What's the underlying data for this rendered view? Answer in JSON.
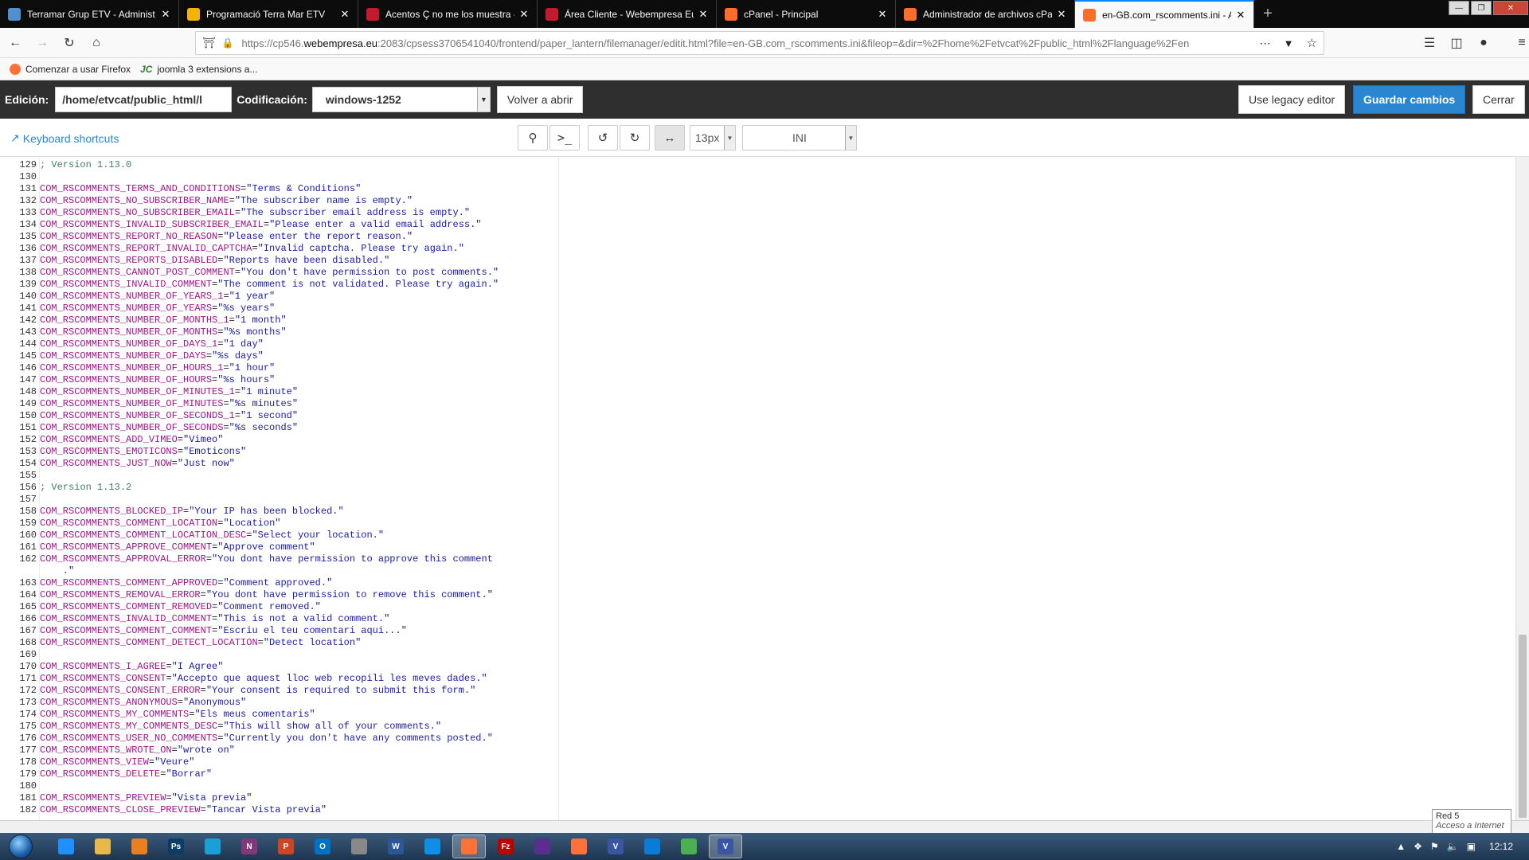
{
  "browser": {
    "tabs": [
      {
        "label": "Terramar Grup ETV - Administ",
        "icon": "joomla-icon",
        "color": "#5091cd"
      },
      {
        "label": "Programació Terra Mar ETV",
        "icon": "google-drive-icon",
        "color": "#f4b400"
      },
      {
        "label": "Acentos Ç no me los muestra -",
        "icon": "webempresa-icon",
        "color": "#c21b2f"
      },
      {
        "label": "Área Cliente - Webempresa Eur",
        "icon": "webempresa-icon",
        "color": "#c21b2f"
      },
      {
        "label": "cPanel - Principal",
        "icon": "cpanel-icon",
        "color": "#ff6c2c"
      },
      {
        "label": "Administrador de archivos cPar",
        "icon": "cpanel-icon",
        "color": "#ff6c2c"
      },
      {
        "label": "en-GB.com_rscomments.ini - A",
        "icon": "cpanel-icon",
        "color": "#ff6c2c"
      }
    ],
    "url_prefix": "https://cp546.",
    "url_domain": "webempresa.eu",
    "url_rest": ":2083/cpsess3706541040/frontend/paper_lantern/filemanager/editit.html?file=en-GB.com_rscomments.ini&fileop=&dir=%2Fhome%2Fetvcat%2Fpublic_html%2Flanguage%2Fen",
    "bookmarks": [
      {
        "label": "Comenzar a usar Firefox",
        "icon": "firefox-icon"
      },
      {
        "label": "joomla 3 extensions a...",
        "icon": "jc-icon"
      }
    ]
  },
  "editor": {
    "edit_label": "Edición:",
    "path_value": "/home/etvcat/public_html/l",
    "encoding_label": "Codificación:",
    "encoding_value": "windows-1252",
    "reopen_label": "Volver a abrir",
    "legacy_label": "Use legacy editor",
    "save_label": "Guardar cambios",
    "close_label": "Cerrar",
    "keyboard_shortcuts": "Keyboard shortcuts",
    "font_size": "13px",
    "mode": "INI"
  },
  "code_lines": [
    {
      "n": "129",
      "t": "comment",
      "text": "; Version 1.13.0"
    },
    {
      "n": "130",
      "t": "blank"
    },
    {
      "n": "131",
      "k": "COM_RSCOMMENTS_TERMS_AND_CONDITIONS",
      "v": "\"Terms & Conditions\""
    },
    {
      "n": "132",
      "k": "COM_RSCOMMENTS_NO_SUBSCRIBER_NAME",
      "v": "\"The subscriber name is empty.\""
    },
    {
      "n": "133",
      "k": "COM_RSCOMMENTS_NO_SUBSCRIBER_EMAIL",
      "v": "\"The subscriber email address is empty.\""
    },
    {
      "n": "134",
      "k": "COM_RSCOMMENTS_INVALID_SUBSCRIBER_EMAIL",
      "v": "\"Please enter a valid email address.\""
    },
    {
      "n": "135",
      "k": "COM_RSCOMMENTS_REPORT_NO_REASON",
      "v": "\"Please enter the report reason.\""
    },
    {
      "n": "136",
      "k": "COM_RSCOMMENTS_REPORT_INVALID_CAPTCHA",
      "v": "\"Invalid captcha. Please try again.\""
    },
    {
      "n": "137",
      "k": "COM_RSCOMMENTS_REPORTS_DISABLED",
      "v": "\"Reports have been disabled.\""
    },
    {
      "n": "138",
      "k": "COM_RSCOMMENTS_CANNOT_POST_COMMENT",
      "v": "\"You don't have permission to post comments.\""
    },
    {
      "n": "139",
      "k": "COM_RSCOMMENTS_INVALID_COMMENT",
      "v": "\"The comment is not validated. Please try again.\""
    },
    {
      "n": "140",
      "k": "COM_RSCOMMENTS_NUMBER_OF_YEARS_1",
      "v": "\"1 year\""
    },
    {
      "n": "141",
      "k": "COM_RSCOMMENTS_NUMBER_OF_YEARS",
      "v": "\"%s years\""
    },
    {
      "n": "142",
      "k": "COM_RSCOMMENTS_NUMBER_OF_MONTHS_1",
      "v": "\"1 month\""
    },
    {
      "n": "143",
      "k": "COM_RSCOMMENTS_NUMBER_OF_MONTHS",
      "v": "\"%s months\""
    },
    {
      "n": "144",
      "k": "COM_RSCOMMENTS_NUMBER_OF_DAYS_1",
      "v": "\"1 day\""
    },
    {
      "n": "145",
      "k": "COM_RSCOMMENTS_NUMBER_OF_DAYS",
      "v": "\"%s days\""
    },
    {
      "n": "146",
      "k": "COM_RSCOMMENTS_NUMBER_OF_HOURS_1",
      "v": "\"1 hour\""
    },
    {
      "n": "147",
      "k": "COM_RSCOMMENTS_NUMBER_OF_HOURS",
      "v": "\"%s hours\""
    },
    {
      "n": "148",
      "k": "COM_RSCOMMENTS_NUMBER_OF_MINUTES_1",
      "v": "\"1 minute\""
    },
    {
      "n": "149",
      "k": "COM_RSCOMMENTS_NUMBER_OF_MINUTES",
      "v": "\"%s minutes\""
    },
    {
      "n": "150",
      "k": "COM_RSCOMMENTS_NUMBER_OF_SECONDS_1",
      "v": "\"1 second\""
    },
    {
      "n": "151",
      "k": "COM_RSCOMMENTS_NUMBER_OF_SECONDS",
      "v": "\"%s seconds\""
    },
    {
      "n": "152",
      "k": "COM_RSCOMMENTS_ADD_VIMEO",
      "v": "\"Vimeo\""
    },
    {
      "n": "153",
      "k": "COM_RSCOMMENTS_EMOTICONS",
      "v": "\"Emoticons\""
    },
    {
      "n": "154",
      "k": "COM_RSCOMMENTS_JUST_NOW",
      "v": "\"Just now\""
    },
    {
      "n": "155",
      "t": "blank"
    },
    {
      "n": "156",
      "t": "comment",
      "text": "; Version 1.13.2"
    },
    {
      "n": "157",
      "t": "blank"
    },
    {
      "n": "158",
      "k": "COM_RSCOMMENTS_BLOCKED_IP",
      "v": "\"Your IP has been blocked.\""
    },
    {
      "n": "159",
      "k": "COM_RSCOMMENTS_COMMENT_LOCATION",
      "v": "\"Location\""
    },
    {
      "n": "160",
      "k": "COM_RSCOMMENTS_COMMENT_LOCATION_DESC",
      "v": "\"Select your location.\""
    },
    {
      "n": "161",
      "k": "COM_RSCOMMENTS_APPROVE_COMMENT",
      "v": "\"Approve comment\""
    },
    {
      "n": "162",
      "k": "COM_RSCOMMENTS_APPROVAL_ERROR",
      "v": "\"You dont have permission to approve this comment",
      "cont": "    .\""
    },
    {
      "n": "163",
      "k": "COM_RSCOMMENTS_COMMENT_APPROVED",
      "v": "\"Comment approved.\""
    },
    {
      "n": "164",
      "k": "COM_RSCOMMENTS_REMOVAL_ERROR",
      "v": "\"You dont have permission to remove this comment.\""
    },
    {
      "n": "165",
      "k": "COM_RSCOMMENTS_COMMENT_REMOVED",
      "v": "\"Comment removed.\""
    },
    {
      "n": "166",
      "k": "COM_RSCOMMENTS_INVALID_COMMENT",
      "v": "\"This is not a valid comment.\""
    },
    {
      "n": "167",
      "k": "COM_RSCOMMENTS_COMMENT_COMMENT",
      "v": "\"Escriu el teu comentari aqui...\""
    },
    {
      "n": "168",
      "k": "COM_RSCOMMENTS_COMMENT_DETECT_LOCATION",
      "v": "\"Detect location\""
    },
    {
      "n": "169",
      "t": "blank"
    },
    {
      "n": "170",
      "k": "COM_RSCOMMENTS_I_AGREE",
      "v": "\"I Agree\""
    },
    {
      "n": "171",
      "k": "COM_RSCOMMENTS_CONSENT",
      "v": "\"Accepto que aquest lloc web recopili les meves dades.\""
    },
    {
      "n": "172",
      "k": "COM_RSCOMMENTS_CONSENT_ERROR",
      "v": "\"Your consent is required to submit this form.\""
    },
    {
      "n": "173",
      "k": "COM_RSCOMMENTS_ANONYMOUS",
      "v": "\"Anonymous\""
    },
    {
      "n": "174",
      "k": "COM_RSCOMMENTS_MY_COMMENTS",
      "v": "\"Els meus comentaris\""
    },
    {
      "n": "175",
      "k": "COM_RSCOMMENTS_MY_COMMENTS_DESC",
      "v": "\"This will show all of your comments.\""
    },
    {
      "n": "176",
      "k": "COM_RSCOMMENTS_USER_NO_COMMENTS",
      "v": "\"Currently you don't have any comments posted.\""
    },
    {
      "n": "177",
      "k": "COM_RSCOMMENTS_WROTE_ON",
      "v": "\"wrote on\""
    },
    {
      "n": "178",
      "k": "COM_RSCOMMENTS_VIEW",
      "v": "\"Veure\""
    },
    {
      "n": "179",
      "k": "COM_RSCOMMENTS_DELETE",
      "v": "\"Borrar\""
    },
    {
      "n": "180",
      "t": "blank"
    },
    {
      "n": "181",
      "k": "COM_RSCOMMENTS_PREVIEW",
      "v": "\"Vista previa\""
    },
    {
      "n": "182",
      "k": "COM_RSCOMMENTS_CLOSE_PREVIEW",
      "v": "\"Tancar Vista previa\""
    }
  ],
  "network_tooltip": {
    "line1": "Red  5",
    "line2": "Acceso a Internet"
  },
  "taskbar": {
    "items": [
      {
        "icon": "ie-icon",
        "color": "#1e90ff"
      },
      {
        "icon": "explorer-icon",
        "color": "#e8b84a"
      },
      {
        "icon": "media-player-icon",
        "color": "#e8801f"
      },
      {
        "icon": "photoshop-icon",
        "color": "#0b3d66",
        "label": "Ps"
      },
      {
        "icon": "globe-icon",
        "color": "#1aa0d8"
      },
      {
        "icon": "onenote-icon",
        "color": "#80397b",
        "label": "N"
      },
      {
        "icon": "powerpoint-icon",
        "color": "#d04423",
        "label": "P"
      },
      {
        "icon": "outlook-icon",
        "color": "#0072c6",
        "label": "O"
      },
      {
        "icon": "app-icon",
        "color": "#888888"
      },
      {
        "icon": "word-icon",
        "color": "#2b579a",
        "label": "W"
      },
      {
        "icon": "teamviewer-icon",
        "color": "#0e8ee9"
      },
      {
        "icon": "firefox-icon",
        "color": "#ff7139",
        "active": true
      },
      {
        "icon": "filezilla-icon",
        "color": "#bf0000",
        "label": "Fz"
      },
      {
        "icon": "app-icon",
        "color": "#5c2d91"
      },
      {
        "icon": "firefox-icon",
        "color": "#ff7139"
      },
      {
        "icon": "visio-icon",
        "color": "#3955a3",
        "label": "V"
      },
      {
        "icon": "edge-icon",
        "color": "#0a7cd8"
      },
      {
        "icon": "chrome-icon",
        "color": "#4caf50"
      },
      {
        "icon": "visio-icon",
        "color": "#3955a3",
        "label": "V",
        "active": true
      }
    ],
    "clock": "12:12"
  }
}
